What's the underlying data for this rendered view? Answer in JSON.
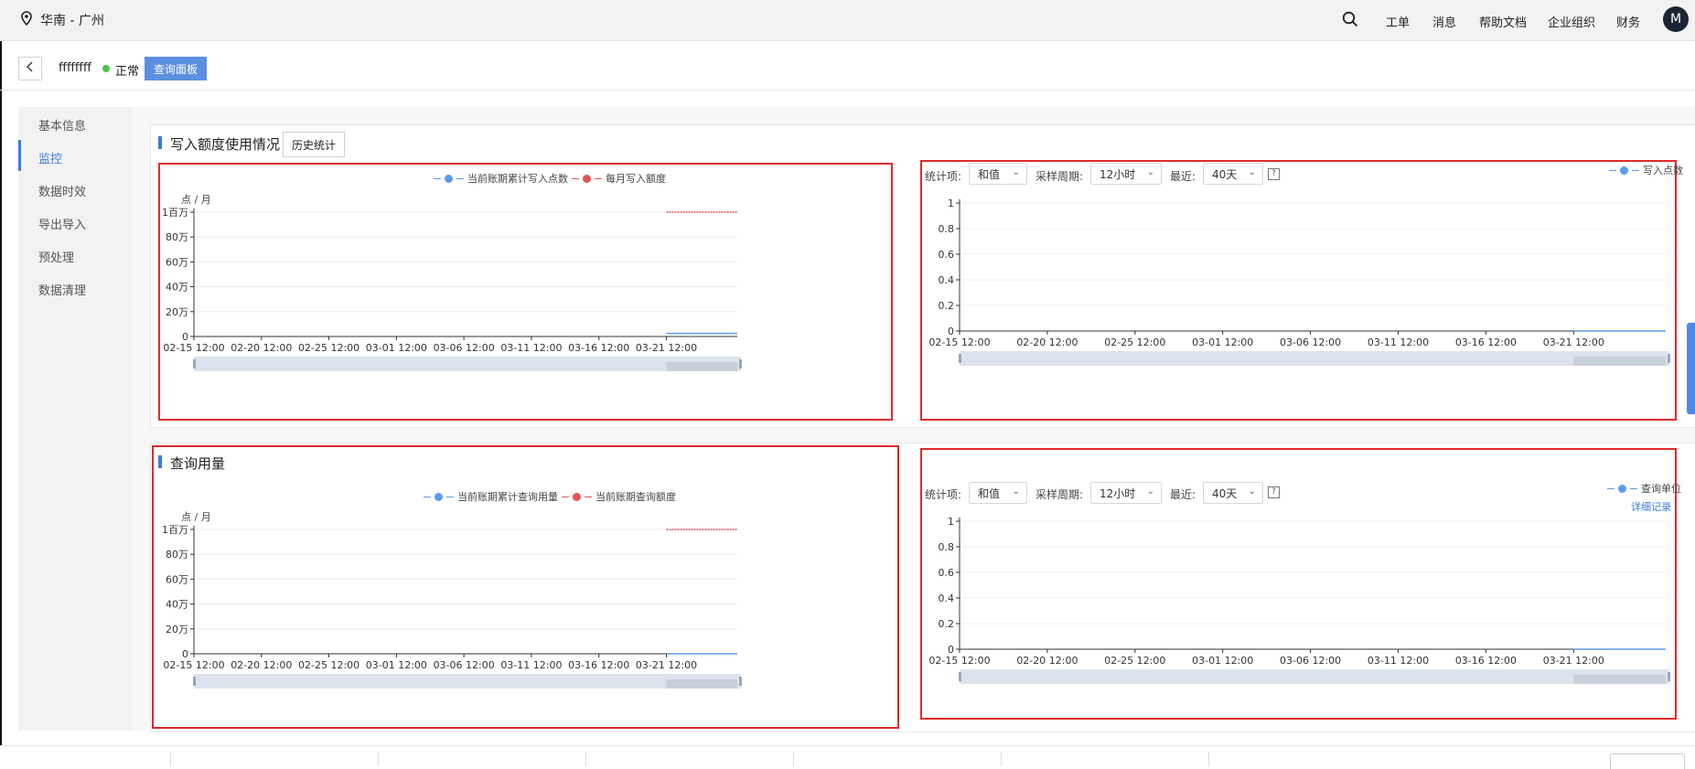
{
  "topbar": {
    "region": "华南 - 广州",
    "nav": [
      "工单",
      "消息",
      "帮助文档",
      "企业组织",
      "财务"
    ],
    "avatar": "M"
  },
  "header": {
    "back": "<",
    "instance_name": "ffffffff",
    "status": "正常",
    "query_panel_button": "查询面板"
  },
  "sidebar": {
    "items": [
      {
        "label": "基本信息"
      },
      {
        "label": "监控"
      },
      {
        "label": "数据时效"
      },
      {
        "label": "导出导入"
      },
      {
        "label": "预处理"
      },
      {
        "label": "数据清理"
      }
    ],
    "active_index": 1
  },
  "write_section": {
    "title": "写入额度使用情况",
    "history_button": "历史统计",
    "left_legend": [
      "当前账期累计写入点数",
      "每月写入额度"
    ],
    "right_legend": "写入点数",
    "controls": {
      "stat_label": "统计项:",
      "stat_value": "和值",
      "period_label": "采样周期:",
      "period_value": "12小时",
      "recent_label": "最近:",
      "recent_value": "40天",
      "help": "?"
    }
  },
  "query_section": {
    "title": "查询用量",
    "left_legend": [
      "当前账期累计查询用量",
      "当前账期查询额度"
    ],
    "right_legend": "查询单位",
    "detail_link": "详细记录",
    "controls": {
      "stat_label": "统计项:",
      "stat_value": "和值",
      "period_label": "采样周期:",
      "period_value": "12小时",
      "recent_label": "最近:",
      "recent_value": "40天",
      "help": "?"
    }
  },
  "colors": {
    "accent": "#3c7be0",
    "series_blue": "#5b9bec",
    "series_red": "#e05555",
    "highlight_border": "#e02a2a",
    "status_green": "#4cc24a"
  },
  "chart_data": [
    {
      "type": "line",
      "unit_label": "点 / 月",
      "x_ticks": [
        "02-15 12:00",
        "02-20 12:00",
        "02-25 12:00",
        "03-01 12:00",
        "03-06 12:00",
        "03-11 12:00",
        "03-16 12:00",
        "03-21 12:00"
      ],
      "y_ticks": [
        "0",
        "20万",
        "40万",
        "60万",
        "80万",
        "1百万"
      ],
      "ylim": [
        0,
        1000000
      ],
      "series": [
        {
          "name": "当前账期累计写入点数",
          "color": "#5b9bec",
          "segment_x": [
            "03-21 12:00",
            "03-25 12:00"
          ],
          "values": [
            25000,
            25000
          ]
        },
        {
          "name": "每月写入额度",
          "color": "#e05555",
          "segment_x": [
            "03-21 12:00",
            "03-25 12:00"
          ],
          "values": [
            1000000,
            1000000
          ]
        }
      ]
    },
    {
      "type": "line",
      "x_ticks": [
        "02-15 12:00",
        "02-20 12:00",
        "02-25 12:00",
        "03-01 12:00",
        "03-06 12:00",
        "03-11 12:00",
        "03-16 12:00",
        "03-21 12:00"
      ],
      "y_ticks": [
        "0",
        "0.2",
        "0.4",
        "0.6",
        "0.8",
        "1"
      ],
      "ylim": [
        0,
        1
      ],
      "series": [
        {
          "name": "写入点数",
          "color": "#5b9bec",
          "segment_x": [
            "03-21 12:00",
            "03-25 12:00"
          ],
          "values": [
            0,
            0
          ]
        }
      ]
    },
    {
      "type": "line",
      "unit_label": "点 / 月",
      "x_ticks": [
        "02-15 12:00",
        "02-20 12:00",
        "02-25 12:00",
        "03-01 12:00",
        "03-06 12:00",
        "03-11 12:00",
        "03-16 12:00",
        "03-21 12:00"
      ],
      "y_ticks": [
        "0",
        "20万",
        "40万",
        "60万",
        "80万",
        "1百万"
      ],
      "ylim": [
        0,
        1000000
      ],
      "series": [
        {
          "name": "当前账期累计查询用量",
          "color": "#5b9bec",
          "segment_x": [
            "03-21 12:00",
            "03-25 12:00"
          ],
          "values": [
            0,
            0
          ]
        },
        {
          "name": "当前账期查询额度",
          "color": "#e05555",
          "segment_x": [
            "03-21 12:00",
            "03-25 12:00"
          ],
          "values": [
            1000000,
            1000000
          ]
        }
      ]
    },
    {
      "type": "line",
      "x_ticks": [
        "02-15 12:00",
        "02-20 12:00",
        "02-25 12:00",
        "03-01 12:00",
        "03-06 12:00",
        "03-11 12:00",
        "03-16 12:00",
        "03-21 12:00"
      ],
      "y_ticks": [
        "0",
        "0.2",
        "0.4",
        "0.6",
        "0.8",
        "1"
      ],
      "ylim": [
        0,
        1
      ],
      "series": [
        {
          "name": "查询单位",
          "color": "#5b9bec",
          "segment_x": [
            "03-21 12:00",
            "03-25 12:00"
          ],
          "values": [
            0,
            0
          ]
        }
      ]
    }
  ]
}
